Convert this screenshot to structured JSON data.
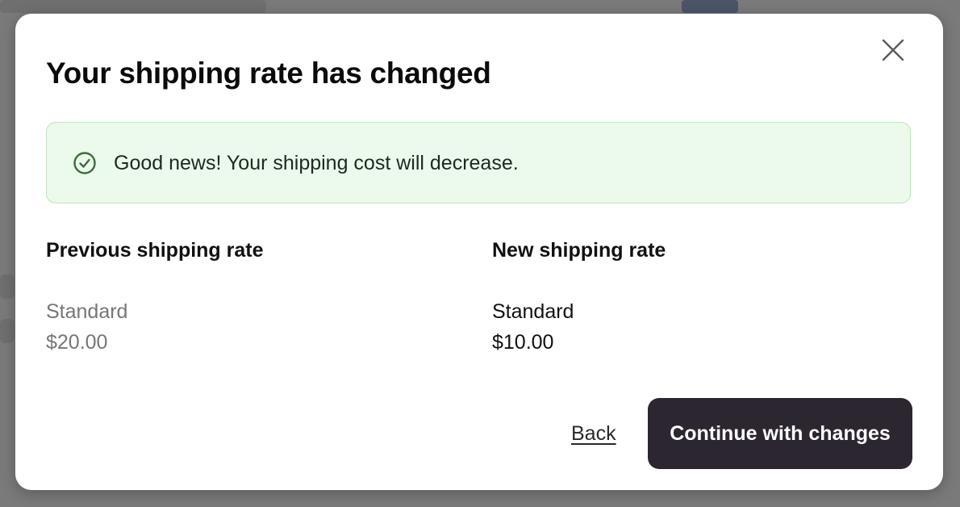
{
  "modal": {
    "title": "Your shipping rate has changed",
    "close_icon": "close-icon"
  },
  "alert": {
    "icon": "check-circle-icon",
    "message": "Good news! Your shipping cost will decrease.",
    "colors": {
      "background": "#ebfaea",
      "border": "#bfe3bf",
      "icon": "#3d6b3d"
    }
  },
  "previous_rate": {
    "heading": "Previous shipping rate",
    "method": "Standard",
    "price": "$20.00"
  },
  "new_rate": {
    "heading": "New shipping rate",
    "method": "Standard",
    "price": "$10.00"
  },
  "actions": {
    "back_label": "Back",
    "continue_label": "Continue with changes",
    "primary_color": "#2c2630"
  }
}
